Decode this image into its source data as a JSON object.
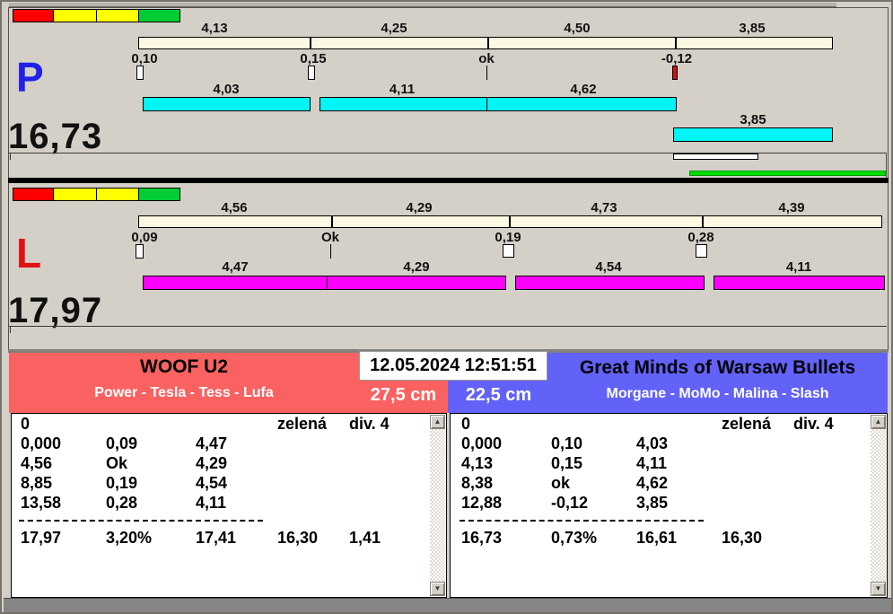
{
  "colors": {
    "background": "#d4d0c8",
    "lane_p_bar": "#00f5f5",
    "lane_l_bar": "#fb00fb",
    "ruler_fill": "#fcf8e2",
    "team_left_bg": "#fa6262",
    "team_right_bg": "#6262f8",
    "status_blocks": [
      "#ff0000",
      "#ffff00",
      "#ffff00",
      "#00cc33"
    ],
    "fault_mark": "#cc1111",
    "progress_green": "#00dd00",
    "lane_p_letter": "#2020e8",
    "lane_l_letter": "#e31212"
  },
  "lane_p": {
    "lane_label": "P",
    "total": "16,73",
    "splits": [
      "4,13",
      "4,25",
      "4,50",
      "3,85"
    ],
    "start_marks": [
      "0,10",
      "0,15",
      "ok",
      "-0,12"
    ],
    "run_times": [
      "4,03",
      "4,11",
      "4,62"
    ],
    "current_run": "3,85"
  },
  "lane_l": {
    "lane_label": "L",
    "total": "17,97",
    "splits": [
      "4,56",
      "4,29",
      "4,73",
      "4,39"
    ],
    "start_marks": [
      "0,09",
      "Ok",
      "0,19",
      "0,28"
    ],
    "run_times": [
      "4,47",
      "4,29",
      "4,54",
      "4,11"
    ]
  },
  "clock": "12.05.2024 12:51:51",
  "team_left": {
    "name": "WOOF U2",
    "members": "Power - Tesla - Tess - Lufa",
    "jump_height": "27,5 cm",
    "table": {
      "first_row": {
        "c1": "0",
        "c4": "zelená",
        "c5": "div. 4"
      },
      "rows": [
        [
          "0,000",
          "0,09",
          "4,47"
        ],
        [
          "4,56",
          "Ok",
          "4,29"
        ],
        [
          "8,85",
          "0,19",
          "4,54"
        ],
        [
          "13,58",
          "0,28",
          "4,11"
        ]
      ],
      "totals": [
        "17,97",
        "3,20%",
        "17,41",
        "16,30",
        "1,41"
      ]
    }
  },
  "team_right": {
    "name": "Great Minds of Warsaw Bullets",
    "members": "Morgane - MoMo - Malina - Slash",
    "jump_height": "22,5 cm",
    "table": {
      "first_row": {
        "c1": "0",
        "c4": "zelená",
        "c5": "div. 4"
      },
      "rows": [
        [
          "0,000",
          "0,10",
          "4,03"
        ],
        [
          "4,13",
          "0,15",
          "4,11"
        ],
        [
          "8,38",
          "ok",
          "4,62"
        ],
        [
          "12,88",
          "-0,12",
          "3,85"
        ]
      ],
      "totals": [
        "16,73",
        "0,73%",
        "16,61",
        "16,30"
      ]
    }
  },
  "scrollbar": {
    "up_glyph": "▲",
    "down_glyph": "▼"
  }
}
